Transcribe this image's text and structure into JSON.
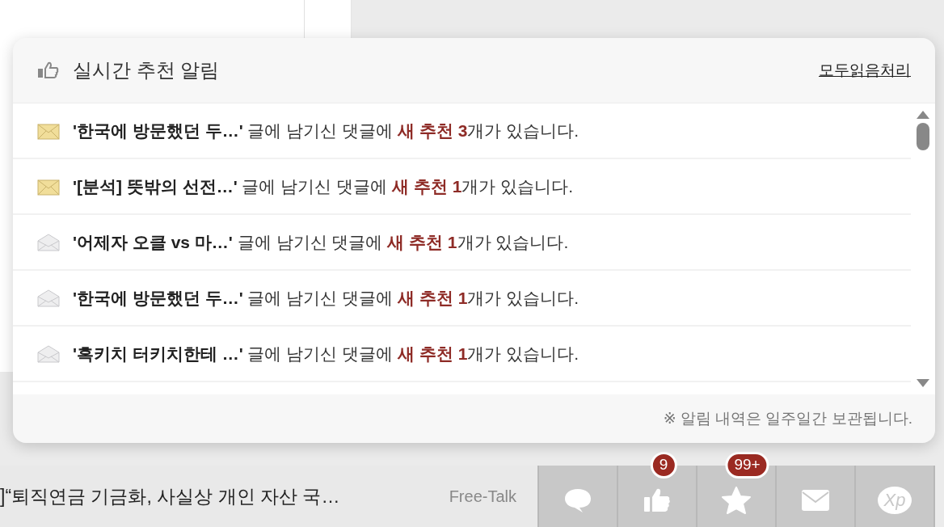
{
  "popup": {
    "title": "실시간 추천 알림",
    "mark_all_read": "모두읽음처리",
    "items": [
      {
        "title": "'한국에 방문했던 두…'",
        "middle": "글에 남기신 댓글에",
        "highlight": "새 추천 3",
        "tail": "개가 있습니다.",
        "read": false
      },
      {
        "title": "'[분석] 뜻밖의 선전…'",
        "middle": "글에 남기신 댓글에",
        "highlight": "새 추천 1",
        "tail": "개가 있습니다.",
        "read": false
      },
      {
        "title": "'어제자 오클 vs 마…'",
        "middle": "글에 남기신 댓글에",
        "highlight": "새 추천 1",
        "tail": "개가 있습니다.",
        "read": true
      },
      {
        "title": "'한국에 방문했던 두…'",
        "middle": "글에 남기신 댓글에",
        "highlight": "새 추천 1",
        "tail": "개가 있습니다.",
        "read": true
      },
      {
        "title": "'흑키치 터키치한테 …'",
        "middle": "글에 남기신 댓글에",
        "highlight": "새 추천 1",
        "tail": "개가 있습니다.",
        "read": true
      }
    ],
    "footer_note": "※ 알림 내역은 일주일간 보관됩니다."
  },
  "bottom_bar": {
    "headline": "]“퇴직연금 기금화, 사실상 개인 자산 국…",
    "board": "Free-Talk",
    "buttons": [
      {
        "kind": "chat"
      },
      {
        "kind": "like",
        "badge": "9"
      },
      {
        "kind": "star",
        "badge": "99+"
      },
      {
        "kind": "mail"
      },
      {
        "kind": "xp",
        "label": "Xp"
      }
    ]
  }
}
